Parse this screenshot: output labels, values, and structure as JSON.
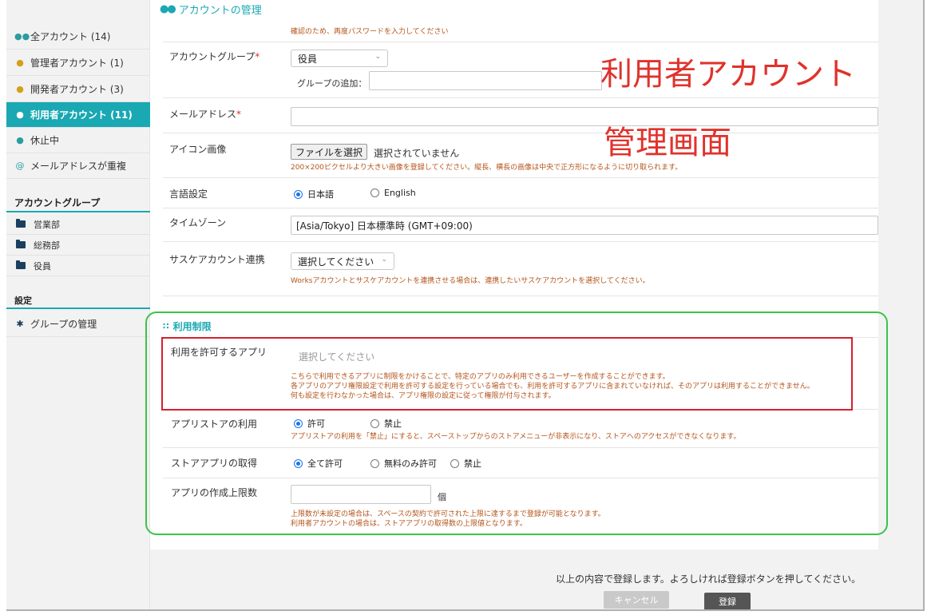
{
  "page_title": "アカウントの管理",
  "sidebar": {
    "items": [
      {
        "label": "全アカウント (14)",
        "icon": "users-icon"
      },
      {
        "label": "管理者アカウント (1)",
        "icon": "admin-icon"
      },
      {
        "label": "開発者アカウント (3)",
        "icon": "developer-icon"
      },
      {
        "label": "利用者アカウント (11)",
        "icon": "user-icon"
      },
      {
        "label": "休止中",
        "icon": "suspended-icon"
      },
      {
        "label": "メールアドレスが重複",
        "icon": "at-icon"
      }
    ],
    "group_heading": "アカウントグループ",
    "groups": [
      "営業部",
      "総務部",
      "役員"
    ],
    "settings_heading": "設定",
    "settings_item": "グループの管理"
  },
  "form": {
    "password_hint": "確認のため、再度パスワードを入力してください",
    "group_label": "アカウントグループ",
    "required_mark": "*",
    "group_selected": "役員",
    "group_add_label": "グループの追加：",
    "email_label": "メールアドレス",
    "icon_label": "アイコン画像",
    "file_button": "ファイルを選択",
    "file_status": "選択されていません",
    "icon_hint": "200×200ピクセルより大きい画像を登録してください。縦長、横長の画像は中央で正方形になるように切り取られます。",
    "language_label": "言語設定",
    "language_options": [
      "日本語",
      "English"
    ],
    "timezone_label": "タイムゾーン",
    "timezone_value": "[Asia/Tokyo] 日本標準時 (GMT+09:00)",
    "sasuke_label": "サスケアカウント連携",
    "sasuke_select": "選択してください",
    "sasuke_hint": "Worksアカウントとサスケアカウントを連携させる場合は、連携したいサスケアカウントを選択してください。"
  },
  "restrictions": {
    "section_title": "利用制限",
    "apps_label": "利用を許可するアプリ",
    "apps_placeholder": "選択してください",
    "apps_hint_1": "こちらで利用できるアプリに制限をかけることで、特定のアプリのみ利用できるユーザーを作成することができます。",
    "apps_hint_2": "各アプリのアプリ権限設定で利用を許可する設定を行っている場合でも、利用を許可するアプリに含まれていなければ、そのアプリは利用することができません。",
    "apps_hint_3": "何も設定を行わなかった場合は、アプリ権限の設定に従って権限が付与されます。",
    "store_label": "アプリストアの利用",
    "store_options": [
      "許可",
      "禁止"
    ],
    "store_hint": "アプリストアの利用を「禁止」にすると、スペーストップからのストアメニューが非表示になり、ストアへのアクセスができなくなります。",
    "acquire_label": "ストアアプリの取得",
    "acquire_options": [
      "全て許可",
      "無料のみ許可",
      "禁止"
    ],
    "limit_label": "アプリの作成上限数",
    "limit_unit": "個",
    "limit_hint_1": "上限数が未設定の場合は、スペースの契約で許可された上限に達するまで登録が可能となります。",
    "limit_hint_2": "利用者アカウントの場合は、ストアアプリの取得数の上限値となります。"
  },
  "footer": {
    "confirm_text": "以上の内容で登録します。よろしければ登録ボタンを押してください。",
    "cancel_button": "キャンセル",
    "submit_button": "登録"
  },
  "annotation": {
    "line1": "利用者アカウント",
    "line2": "管理画面"
  },
  "colors": {
    "accent": "#1aa8b3",
    "hint": "#b4541a",
    "annotation": "#e0322c",
    "green_frame": "#3cc34a",
    "red_frame": "#d6202f"
  }
}
